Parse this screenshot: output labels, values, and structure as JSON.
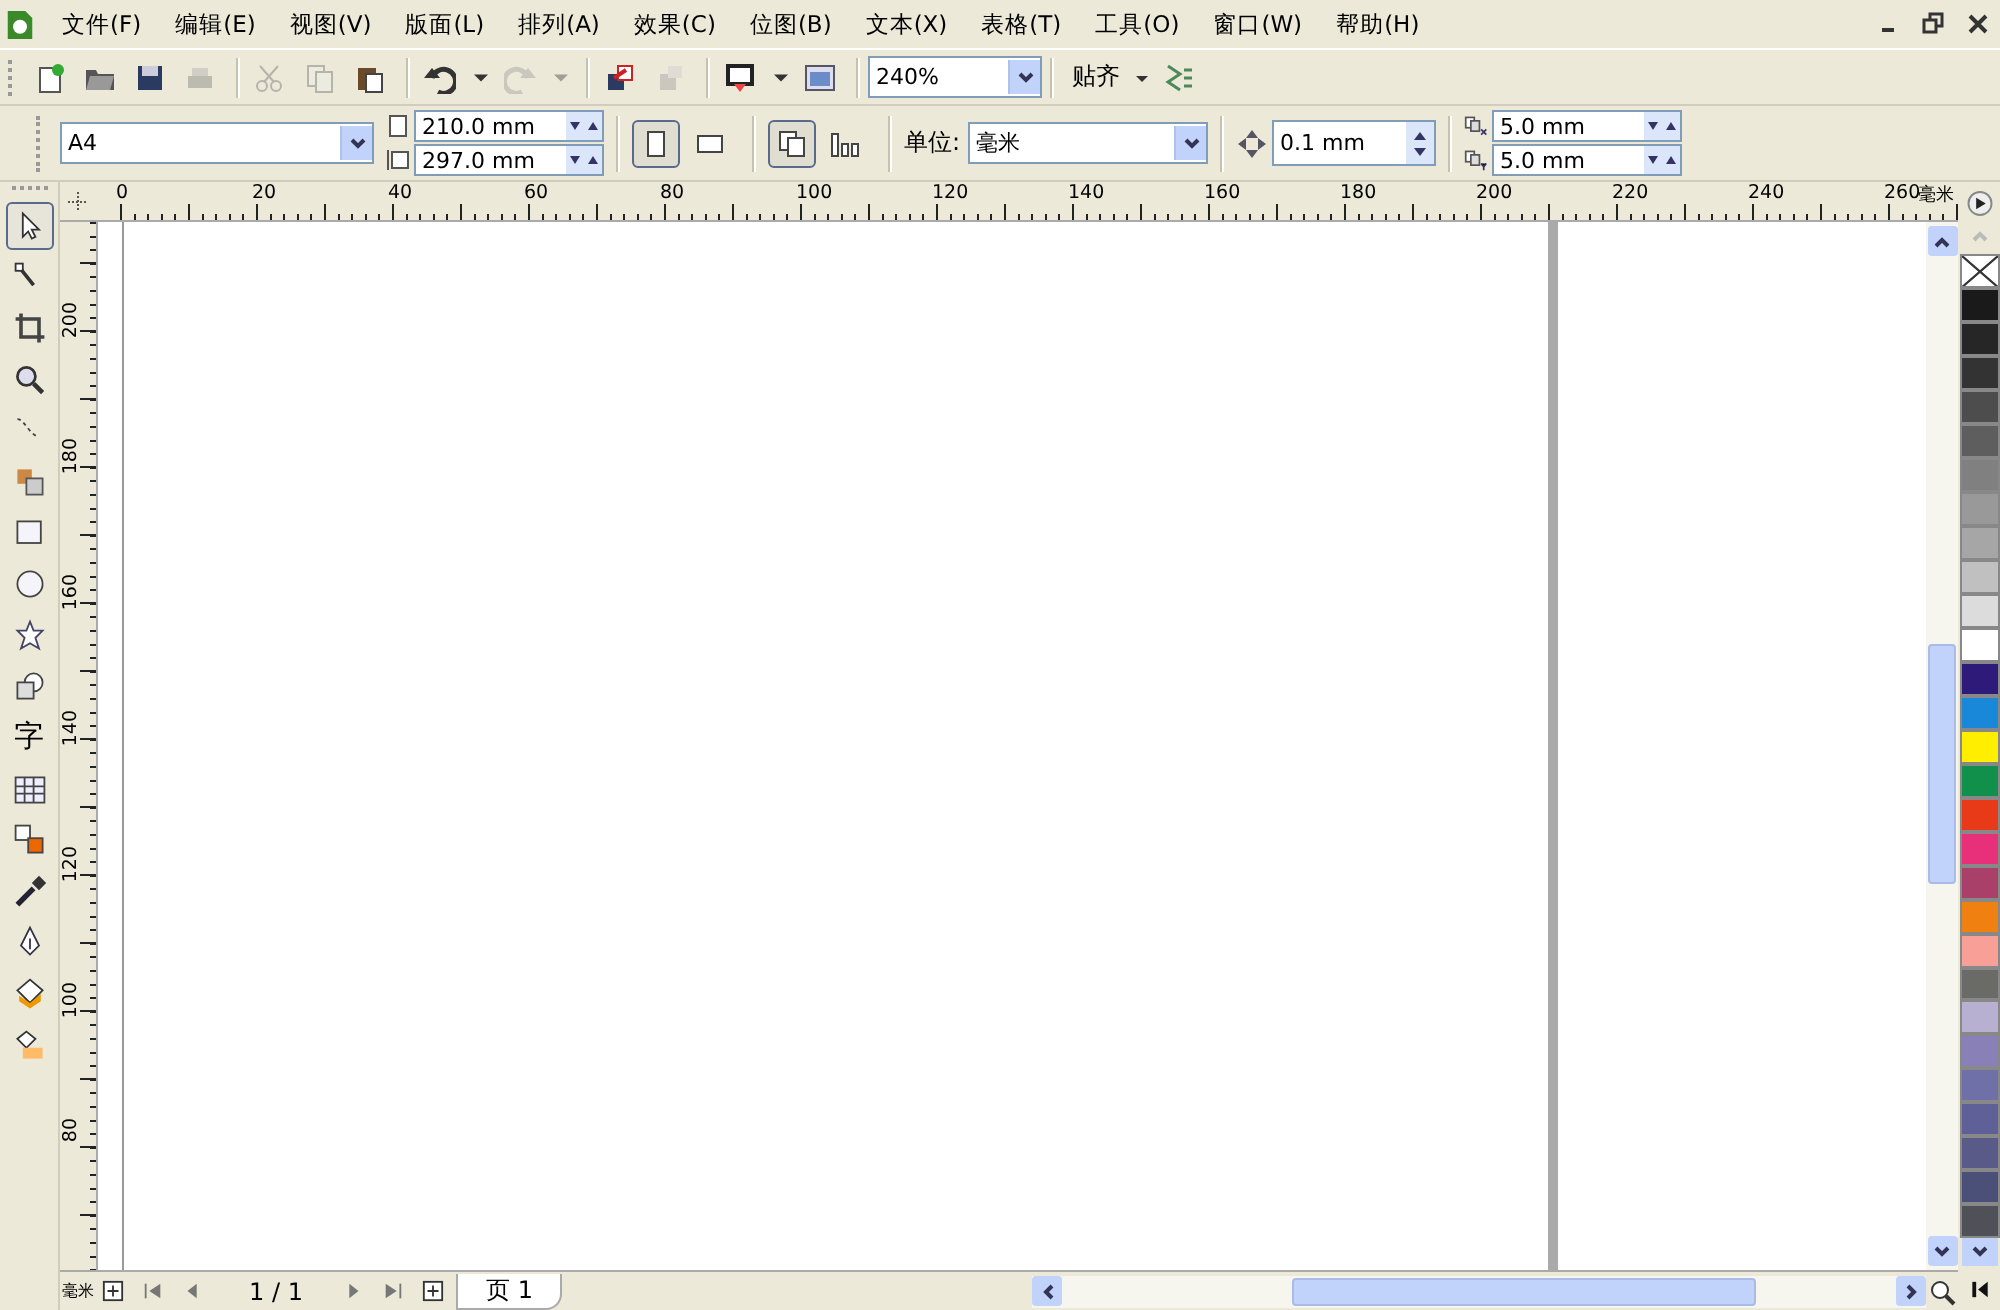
{
  "menu_bar": {
    "items": [
      "文件(F)",
      "编辑(E)",
      "视图(V)",
      "版面(L)",
      "排列(A)",
      "效果(C)",
      "位图(B)",
      "文本(X)",
      "表格(T)",
      "工具(O)",
      "窗口(W)",
      "帮助(H)"
    ]
  },
  "standard_toolbar": {
    "buttons": [
      {
        "disabled": false
      },
      {
        "disabled": false
      },
      {
        "disabled": false
      },
      {
        "disabled": true
      },
      {
        "disabled": true
      },
      {
        "disabled": true
      },
      {
        "disabled": false
      },
      {
        "disabled": false
      },
      {
        "disabled": false
      },
      {
        "disabled": true
      },
      {
        "disabled": true
      },
      {
        "disabled": false
      },
      {
        "disabled": true
      },
      {
        "disabled": false
      },
      {
        "disabled": false
      },
      {
        "disabled": false
      }
    ],
    "zoom": "240%",
    "snap_label": "贴齐"
  },
  "property_bar": {
    "paper": "A4",
    "width": "210.0 mm",
    "height": "297.0 mm",
    "orientation": [
      {
        "selected": true
      },
      {
        "selected": false
      }
    ],
    "page_scope": [
      {
        "selected": true
      },
      {
        "selected": false
      }
    ],
    "units_label": "单位:",
    "units": "毫米",
    "nudge": "0.1 mm",
    "duplicate_x": "5.0 mm",
    "duplicate_y": "5.0 mm"
  },
  "toolbox": [
    {
      "selected": true
    },
    {
      "selected": false
    },
    {
      "selected": false
    },
    {
      "selected": false
    },
    {
      "selected": false
    },
    {
      "selected": false
    },
    {
      "selected": false
    },
    {
      "selected": false
    },
    {
      "selected": false
    },
    {
      "selected": false
    },
    {
      "selected": false,
      "glyph": "字"
    },
    {
      "selected": false
    },
    {
      "selected": false
    },
    {
      "selected": false
    },
    {
      "selected": false
    },
    {
      "selected": false
    },
    {
      "selected": false
    }
  ],
  "horizontal_ruler": {
    "labels": [
      "0",
      "20",
      "40",
      "60",
      "80",
      "100",
      "120",
      "140",
      "160",
      "180",
      "200",
      "220",
      "240",
      "260"
    ],
    "unit": "毫米"
  },
  "vertical_ruler": {
    "labels": [
      "200",
      "180",
      "160",
      "140",
      "120",
      "100",
      "80"
    ],
    "unit": "毫米"
  },
  "page_navigator": {
    "position": "1 / 1",
    "tabs": [
      {
        "label": "页 1",
        "selected": true
      }
    ]
  },
  "palette": [
    {
      "kind": "none"
    },
    {
      "kind": "swatch",
      "color": "#1a1a1a"
    },
    {
      "kind": "swatch",
      "color": "#262626"
    },
    {
      "kind": "swatch",
      "color": "#333333"
    },
    {
      "kind": "swatch",
      "color": "#4d4d4d"
    },
    {
      "kind": "swatch",
      "color": "#5e5e5e"
    },
    {
      "kind": "swatch",
      "color": "#808080"
    },
    {
      "kind": "swatch",
      "color": "#999999"
    },
    {
      "kind": "swatch",
      "color": "#a6a6a6"
    },
    {
      "kind": "swatch",
      "color": "#c0c0c0"
    },
    {
      "kind": "swatch",
      "color": "#dcdcdc"
    },
    {
      "kind": "swatch",
      "color": "#ffffff"
    },
    {
      "kind": "swatch",
      "color": "#2e1a78"
    },
    {
      "kind": "swatch",
      "color": "#1a88d8"
    },
    {
      "kind": "swatch",
      "color": "#ffee00"
    },
    {
      "kind": "swatch",
      "color": "#10904a"
    },
    {
      "kind": "swatch",
      "color": "#e83a18"
    },
    {
      "kind": "swatch",
      "color": "#e8307a"
    },
    {
      "kind": "swatch",
      "color": "#a8406a"
    },
    {
      "kind": "swatch",
      "color": "#f08010"
    },
    {
      "kind": "swatch",
      "color": "#f8a098"
    },
    {
      "kind": "swatch",
      "color": "#6a6a66"
    },
    {
      "kind": "swatch",
      "color": "#b8b0d0"
    },
    {
      "kind": "swatch",
      "color": "#8a80b8"
    },
    {
      "kind": "swatch",
      "color": "#7070a8"
    },
    {
      "kind": "swatch",
      "color": "#606098"
    },
    {
      "kind": "swatch",
      "color": "#5a5a88"
    },
    {
      "kind": "swatch",
      "color": "#4a5078"
    },
    {
      "kind": "swatch",
      "color": "#505058"
    }
  ]
}
